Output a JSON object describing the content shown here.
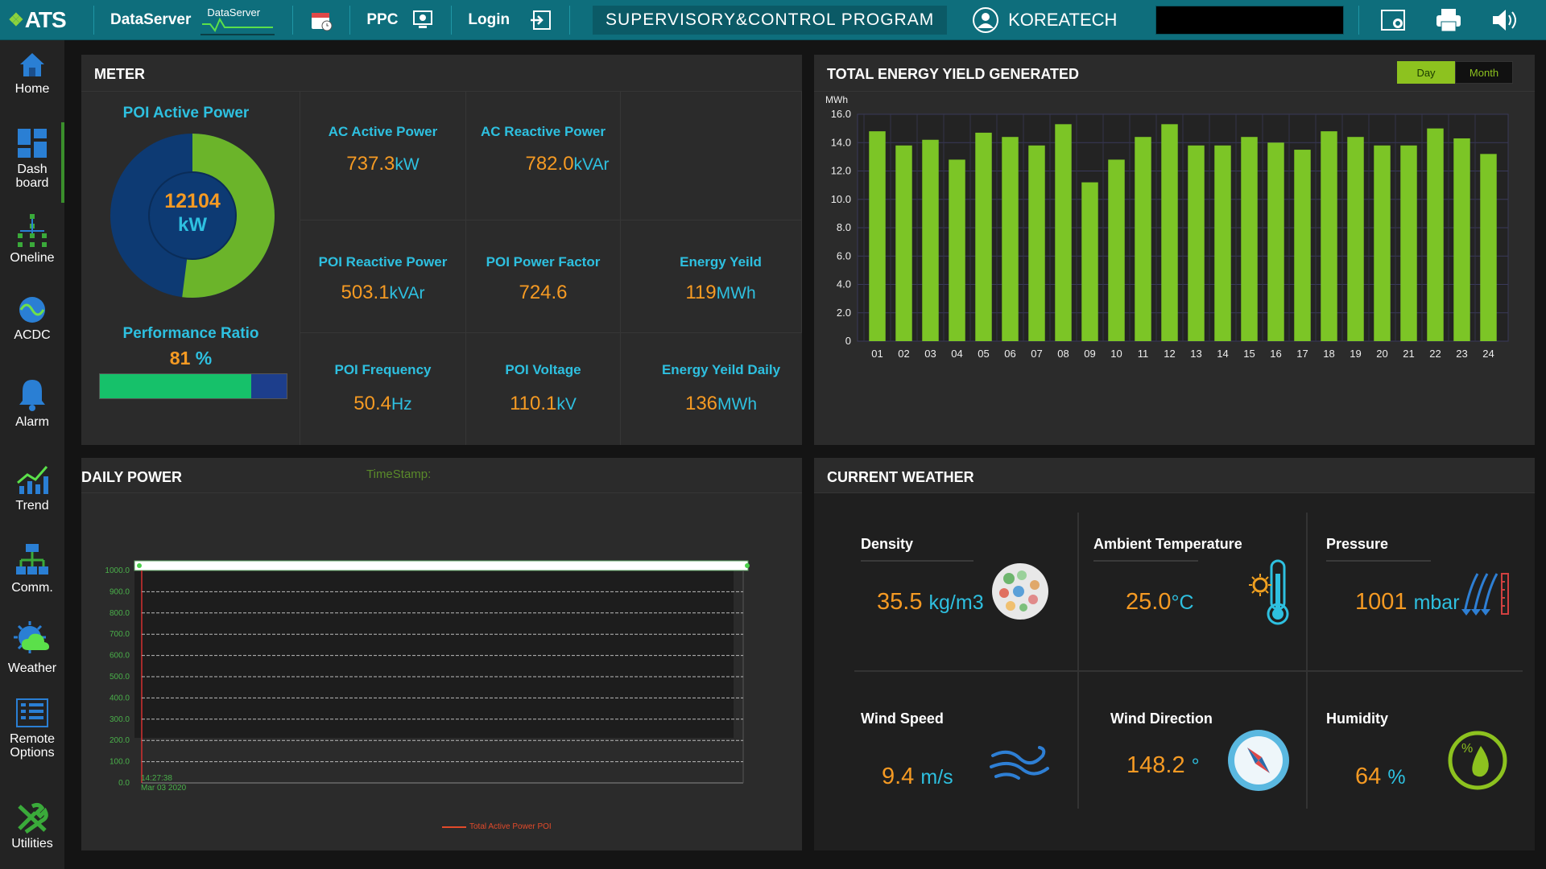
{
  "topbar": {
    "logo": "ATS",
    "dataserver_label": "DataServer",
    "dataserver_mini_label": "DataServer",
    "ppc_label": "PPC",
    "login_label": "Login",
    "program_title": "SUPERVISORY&CONTROL PROGRAM",
    "user": "KOREATECH"
  },
  "sidebar": {
    "items": [
      {
        "label": "Home",
        "icon": "home-icon"
      },
      {
        "label": "Dash board",
        "icon": "dashboard-icon"
      },
      {
        "label": "Oneline",
        "icon": "oneline-icon"
      },
      {
        "label": "ACDC",
        "icon": "acdc-icon"
      },
      {
        "label": "Alarm",
        "icon": "alarm-icon"
      },
      {
        "label": "Trend",
        "icon": "trend-icon"
      },
      {
        "label": "Comm.",
        "icon": "comm-icon"
      },
      {
        "label": "Weather",
        "icon": "weather-icon"
      },
      {
        "label": "Remote Options",
        "icon": "remote-options-icon"
      },
      {
        "label": "Utilities",
        "icon": "utilities-icon"
      }
    ]
  },
  "meter": {
    "title": "METER",
    "poi_active_power": {
      "label": "POI Active Power",
      "value": "12104",
      "unit": "kW",
      "fill_fraction": 0.52
    },
    "performance_ratio": {
      "label": "Performance Ratio",
      "value": "81",
      "unit": "%",
      "fill_fraction": 0.81
    },
    "cells": [
      {
        "label": "AC Active Power",
        "value": "737.3",
        "unit": "kW"
      },
      {
        "label": "AC Reactive Power",
        "value": "782.0",
        "unit": "kVAr"
      },
      {
        "label": "POI Reactive Power",
        "value": "503.1",
        "unit": "kVAr"
      },
      {
        "label": "POI Power Factor",
        "value": "724.6",
        "unit": ""
      },
      {
        "label": "Energy Yeild",
        "value": "119",
        "unit": "MWh"
      },
      {
        "label": "POI Frequency",
        "value": "50.4",
        "unit": "Hz"
      },
      {
        "label": "POI Voltage",
        "value": "110.1",
        "unit": "kV"
      },
      {
        "label": "Energy Yeild Daily",
        "value": "136",
        "unit": "MWh"
      }
    ]
  },
  "energy": {
    "title": "TOTAL ENERGY YIELD GENERATED",
    "day_label": "Day",
    "month_label": "Month"
  },
  "daily_power": {
    "title": "DAILY POWER",
    "timestamp_label": "TimeStamp:",
    "x_time": "14:27:38",
    "x_date": "Mar 03 2020",
    "legend": "Total Active Power POI",
    "yticks": [
      "1000.0",
      "900.0",
      "800.0",
      "700.0",
      "600.0",
      "500.0",
      "400.0",
      "300.0",
      "200.0",
      "100.0",
      "0.0"
    ]
  },
  "weather": {
    "title": "CURRENT WEATHER",
    "density": {
      "label": "Density",
      "value": "35.5",
      "unit": "kg/m3"
    },
    "ambient_temperature": {
      "label": "Ambient Temperature",
      "value": "25.0",
      "unit": "°C"
    },
    "pressure": {
      "label": "Pressure",
      "value": "1001",
      "unit": "mbar"
    },
    "wind_speed": {
      "label": "Wind Speed",
      "value": "9.4",
      "unit": "m/s"
    },
    "wind_direction": {
      "label": "Wind Direction",
      "value": "148.2",
      "unit": "°"
    },
    "humidity": {
      "label": "Humidity",
      "value": "64",
      "unit": "%"
    }
  },
  "chart_data": {
    "type": "bar",
    "title": "",
    "ylabel": "MWh",
    "xlabel": "",
    "ylim": [
      0,
      16
    ],
    "yticks": [
      "0",
      "2.0",
      "4.0",
      "6.0",
      "8.0",
      "10.0",
      "12.0",
      "14.0",
      "16.0"
    ],
    "categories": [
      "01",
      "02",
      "03",
      "04",
      "05",
      "06",
      "07",
      "08",
      "09",
      "10",
      "11",
      "12",
      "13",
      "14",
      "15",
      "16",
      "17",
      "18",
      "19",
      "20",
      "21",
      "22",
      "23",
      "24"
    ],
    "values": [
      14.8,
      13.8,
      14.2,
      12.8,
      14.7,
      14.4,
      13.8,
      15.3,
      11.2,
      12.8,
      14.4,
      15.3,
      13.8,
      13.8,
      14.4,
      14.0,
      13.5,
      14.8,
      14.4,
      13.8,
      13.8,
      15.0,
      14.3,
      13.2
    ],
    "color": "#7cc526"
  },
  "colors": {
    "accent_teal": "#0e6e7c",
    "value_orange": "#f59a23",
    "label_cyan": "#2ec0e0",
    "bar_green": "#7cc526"
  }
}
